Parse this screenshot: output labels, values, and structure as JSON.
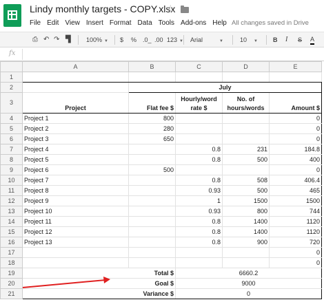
{
  "app": {
    "doc_title": "Lindy monthly targets - COPY.xlsx",
    "save_status": "All changes saved in Drive",
    "menu": [
      "File",
      "Edit",
      "View",
      "Insert",
      "Format",
      "Data",
      "Tools",
      "Add-ons",
      "Help"
    ]
  },
  "toolbar": {
    "zoom": "100%",
    "currency": "$",
    "percent": "%",
    "dec_less": ".0_",
    "dec_more": ".00",
    "more_formats": "123",
    "font": "Arial",
    "font_size": "10",
    "bold": "B",
    "italic": "I",
    "strike": "S",
    "text_color": "A"
  },
  "formula_bar": {
    "fx": "fx",
    "value": ""
  },
  "sheet": {
    "columns": [
      "A",
      "B",
      "C",
      "D",
      "E"
    ],
    "rows_header": {
      "month": "July",
      "project": "Project",
      "flat_fee": "Flat fee  $",
      "hourly_rate_1": "Hourly/word",
      "hourly_rate_2": "rate $",
      "hours_1": "No. of",
      "hours_2": "hours/words",
      "amount": "Amount $"
    },
    "projects": [
      {
        "n": "4",
        "a": "Project 1",
        "b": "800",
        "c": "",
        "d": "",
        "e": "0"
      },
      {
        "n": "5",
        "a": "Project 2",
        "b": "280",
        "c": "",
        "d": "",
        "e": "0"
      },
      {
        "n": "6",
        "a": "Project 3",
        "b": "650",
        "c": "",
        "d": "",
        "e": "0"
      },
      {
        "n": "7",
        "a": "Project 4",
        "b": "",
        "c": "0.8",
        "d": "231",
        "e": "184.8"
      },
      {
        "n": "8",
        "a": "Project 5",
        "b": "",
        "c": "0.8",
        "d": "500",
        "e": "400"
      },
      {
        "n": "9",
        "a": "Project 6",
        "b": "500",
        "c": "",
        "d": "",
        "e": "0"
      },
      {
        "n": "10",
        "a": "Project 7",
        "b": "",
        "c": "0.8",
        "d": "508",
        "e": "406.4"
      },
      {
        "n": "11",
        "a": "Project 8",
        "b": "",
        "c": "0.93",
        "d": "500",
        "e": "465"
      },
      {
        "n": "12",
        "a": "Project 9",
        "b": "",
        "c": "1",
        "d": "1500",
        "e": "1500"
      },
      {
        "n": "13",
        "a": "Project 10",
        "b": "",
        "c": "0.93",
        "d": "800",
        "e": "744"
      },
      {
        "n": "14",
        "a": "Project 11",
        "b": "",
        "c": "0.8",
        "d": "1400",
        "e": "1120"
      },
      {
        "n": "15",
        "a": "Project 12",
        "b": "",
        "c": "0.8",
        "d": "1400",
        "e": "1120"
      },
      {
        "n": "16",
        "a": "Project 13",
        "b": "",
        "c": "0.8",
        "d": "900",
        "e": "720"
      },
      {
        "n": "17",
        "a": "",
        "b": "",
        "c": "",
        "d": "",
        "e": "0"
      },
      {
        "n": "18",
        "a": "",
        "b": "",
        "c": "",
        "d": "",
        "e": "0"
      }
    ],
    "summary": [
      {
        "n": "19",
        "label": "Total $",
        "value": "6660.2"
      },
      {
        "n": "20",
        "label": "Goal $",
        "value": "9000"
      },
      {
        "n": "21",
        "label": "Variance $",
        "value": "0"
      }
    ],
    "row_numbers_top": [
      "1",
      "2",
      "3"
    ]
  },
  "annotation": {
    "arrow_color": "#e02020"
  }
}
